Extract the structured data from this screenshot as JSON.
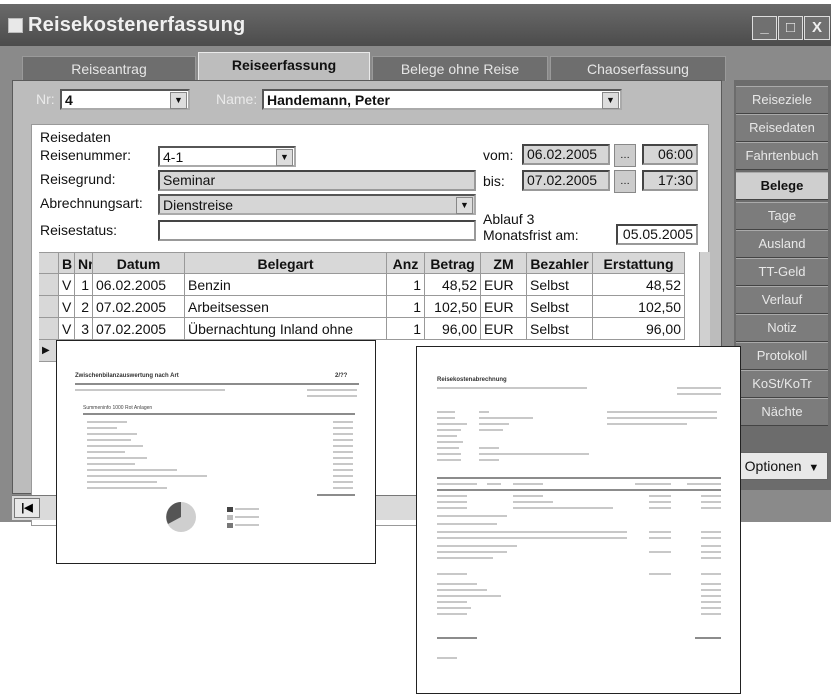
{
  "window": {
    "title": "Reisekostenerfassung",
    "controls": [
      "_",
      "□",
      "X"
    ]
  },
  "tabs": [
    "Reiseantrag",
    "Reiseerfassung",
    "Belege ohne Reise",
    "Chaoserfassung"
  ],
  "active_tab": "Reiseerfassung",
  "header": {
    "nr_label": "Nr:",
    "nr_value": "4",
    "name_label": "Name:",
    "name_value": "Handemann, Peter"
  },
  "reisedaten": {
    "group_label": "Reisedaten",
    "reisenummer_label": "Reisenummer:",
    "reisenummer_value": "4-1",
    "reisegrund_label": "Reisegrund:",
    "reisegrund_value": "Seminar",
    "abrechnungsart_label": "Abrechnungsart:",
    "abrechnungsart_value": "Dienstreise",
    "reisestatus_label": "Reisestatus:",
    "reisestatus_value": "",
    "vom_label": "vom:",
    "vom_date": "06.02.2005",
    "vom_time": "06:00",
    "bis_label": "bis:",
    "bis_date": "07.02.2005",
    "bis_time": "17:30",
    "ablauf_label": "Ablauf 3",
    "monatsfrist_label": "Monatsfrist am:",
    "monatsfrist_value": "05.05.2005"
  },
  "table": {
    "columns": [
      "B",
      "Nr",
      "Datum",
      "Belegart",
      "Anz",
      "Betrag",
      "ZM",
      "Bezahler",
      "Erstattung"
    ],
    "rows": [
      [
        "V",
        "1",
        "06.02.2005",
        "Benzin",
        "1",
        "48,52",
        "EUR",
        "Selbst",
        "48,52"
      ],
      [
        "V",
        "2",
        "07.02.2005",
        "Arbeitsessen",
        "1",
        "102,50",
        "EUR",
        "Selbst",
        "102,50"
      ],
      [
        "V",
        "3",
        "07.02.2005",
        "Übernachtung Inland ohne",
        "1",
        "96,00",
        "EUR",
        "Selbst",
        "96,00"
      ]
    ]
  },
  "sidebar": {
    "items": [
      "Reiseziele",
      "Reisedaten",
      "Fahrtenbuch",
      "Belege",
      "Tage",
      "Ausland",
      "TT-Geld",
      "Verlauf",
      "Notiz",
      "Protokoll",
      "KoSt/KoTr",
      "Nächte"
    ],
    "active": "Belege",
    "options_label": "Optionen"
  },
  "report1": {
    "title": "Zwischenbilanzauswertung nach Art",
    "page": "2/??",
    "section": "Summeninfo  1000 Rot Anlagen"
  },
  "report2": {
    "title": "Reisekostenabrechnung"
  },
  "colors": {
    "titlebar": "#555555",
    "frame": "#8a8a8a",
    "pane": "#bcbcbc",
    "sidebar": "#6c6c6c"
  }
}
